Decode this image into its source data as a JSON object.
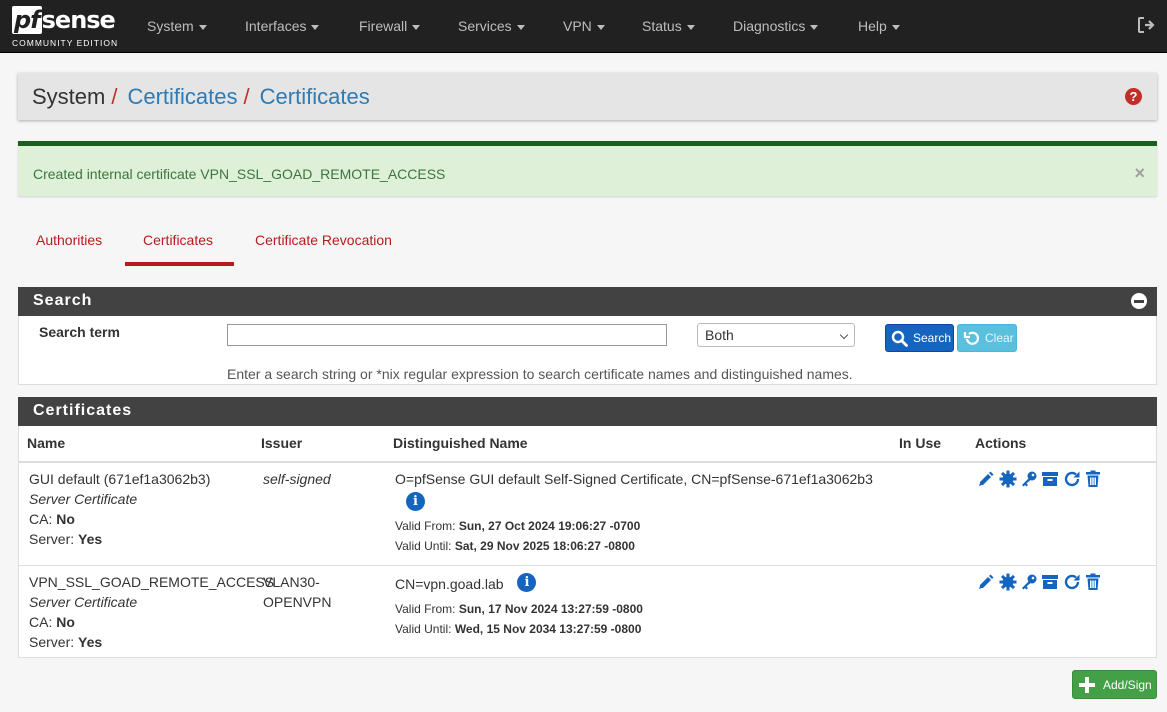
{
  "nav": {
    "brand": {
      "top": "sense",
      "pf": "pf",
      "edition": "COMMUNITY EDITION"
    },
    "menu": [
      "System",
      "Interfaces",
      "Firewall",
      "Services",
      "VPN",
      "Status",
      "Diagnostics",
      "Help"
    ]
  },
  "breadcrumb": {
    "system": "System",
    "sep": "/",
    "item1": "Certificates",
    "item2": "Certificates"
  },
  "alert": {
    "message": "Created internal certificate VPN_SSL_GOAD_REMOTE_ACCESS",
    "close": "×"
  },
  "tabs": [
    "Authorities",
    "Certificates",
    "Certificate Revocation"
  ],
  "search_panel": {
    "title": "Search",
    "label": "Search term",
    "input_value": "",
    "select_value": "Both",
    "search_button": "Search",
    "clear_button": "Clear",
    "help": "Enter a search string or *nix regular expression to search certificate names and distinguished names."
  },
  "cert_panel": {
    "title": "Certificates",
    "columns": [
      "Name",
      "Issuer",
      "Distinguished Name",
      "In Use",
      "Actions"
    ],
    "rows": [
      {
        "name": "GUI default (671ef1a3062b3)",
        "type": "Server Certificate",
        "ca_label": "CA:",
        "ca_value": "No",
        "server_label": "Server:",
        "server_value": "Yes",
        "issuer": "self-signed",
        "issuer_line2": "",
        "dn": "O=pfSense GUI default Self-Signed Certificate, CN=pfSense-671ef1a3062b3",
        "valid_from_label": "Valid From:",
        "valid_from": "Sun, 27 Oct 2024 19:06:27 -0700",
        "valid_until_label": "Valid Until:",
        "valid_until": "Sat, 29 Nov 2025 18:06:27 -0800",
        "in_use": ""
      },
      {
        "name": "VPN_SSL_GOAD_REMOTE_ACCESS",
        "type": "Server Certificate",
        "ca_label": "CA:",
        "ca_value": "No",
        "server_label": "Server:",
        "server_value": "Yes",
        "issuer": "VLAN30-",
        "issuer_line2": "OPENVPN",
        "dn": "CN=vpn.goad.lab",
        "valid_from_label": "Valid From:",
        "valid_from": "Sun, 17 Nov 2024 13:27:59 -0800",
        "valid_until_label": "Valid Until:",
        "valid_until": "Wed, 15 Nov 2034 13:27:59 -0800",
        "in_use": ""
      }
    ],
    "action_icons": [
      "pencil-icon",
      "gear-icon",
      "key-icon",
      "archive-icon",
      "renew-icon",
      "trash-icon"
    ]
  },
  "add_button": "Add/Sign",
  "colors": {
    "navbar": "#212121",
    "accent_red": "#b71c1c",
    "link_blue": "#2e7bb5",
    "icon_blue": "#1565c0",
    "success_green": "#43a047"
  }
}
